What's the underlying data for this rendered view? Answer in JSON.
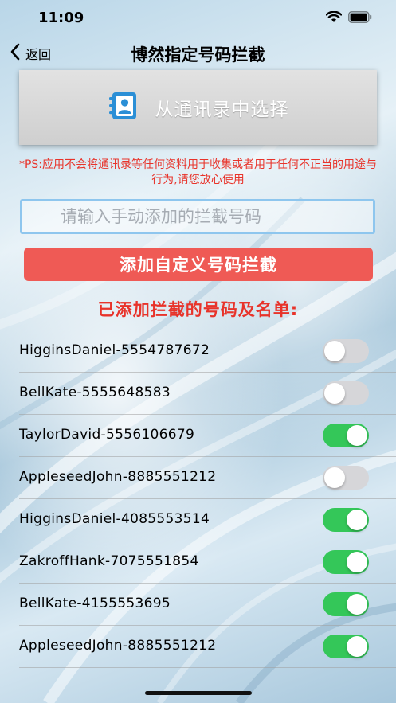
{
  "status_bar": {
    "time": "11:09"
  },
  "nav": {
    "back_label": "返回",
    "title": "博然指定号码拦截"
  },
  "contacts_button": {
    "label": "从通讯录中选择",
    "icon": "contacts-book-icon"
  },
  "ps_note": {
    "text": "*PS:应用不会将通讯录等任何资料用于收集或者用于任何不正当的用途与行为,请您放心使用"
  },
  "number_input": {
    "value": "",
    "placeholder": "请输入手动添加的拦截号码"
  },
  "add_button": {
    "label": "添加自定义号码拦截"
  },
  "list": {
    "heading": "已添加拦截的号码及名单:",
    "items": [
      {
        "label": "HigginsDaniel-5554787672",
        "on": false
      },
      {
        "label": "BellKate-5555648583",
        "on": false
      },
      {
        "label": "TaylorDavid-5556106679",
        "on": true
      },
      {
        "label": "AppleseedJohn-8885551212",
        "on": false
      },
      {
        "label": "HigginsDaniel-4085553514",
        "on": true
      },
      {
        "label": "ZakroffHank-7075551854",
        "on": true
      },
      {
        "label": "BellKate-4155553695",
        "on": true
      },
      {
        "label": "AppleseedJohn-8885551212",
        "on": true
      }
    ]
  },
  "colors": {
    "accent_red": "#ef5a55",
    "note_red": "#e8332a",
    "toggle_on": "#34c759",
    "toggle_off": "#d6d6d9",
    "input_border": "#8ec6ee"
  }
}
